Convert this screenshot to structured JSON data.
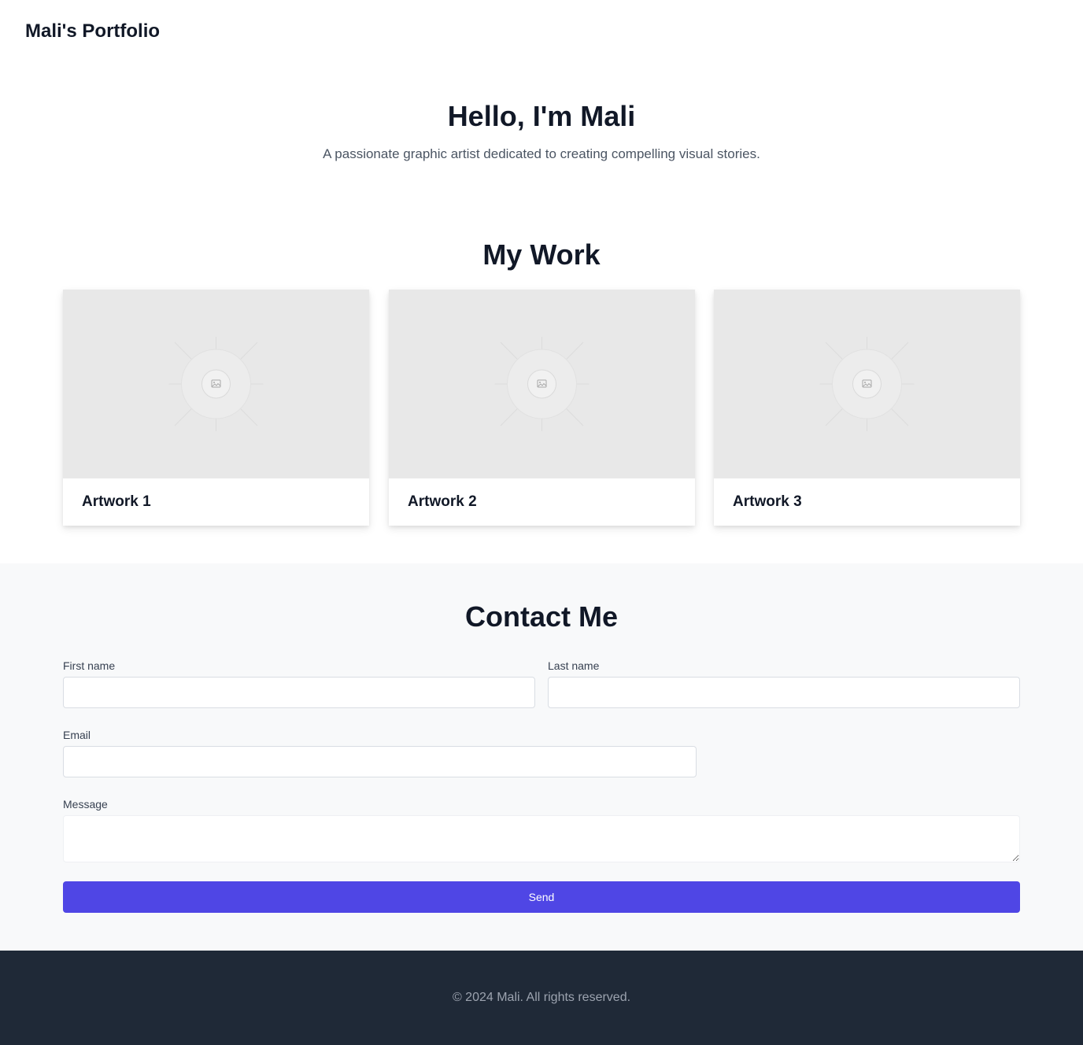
{
  "header": {
    "brand": "Mali's Portfolio"
  },
  "hero": {
    "title": "Hello, I'm Mali",
    "subtitle": "A passionate graphic artist dedicated to creating compelling visual stories."
  },
  "work": {
    "title": "My Work",
    "items": [
      {
        "label": "Artwork 1",
        "icon": "image-placeholder-icon"
      },
      {
        "label": "Artwork 2",
        "icon": "image-placeholder-icon"
      },
      {
        "label": "Artwork 3",
        "icon": "image-placeholder-icon"
      }
    ]
  },
  "contact": {
    "title": "Contact Me",
    "first_name": {
      "label": "First name",
      "value": ""
    },
    "last_name": {
      "label": "Last name",
      "value": ""
    },
    "email": {
      "label": "Email",
      "value": ""
    },
    "message": {
      "label": "Message",
      "value": ""
    },
    "send_label": "Send"
  },
  "footer": {
    "text": "© 2024 Mali. All rights reserved."
  },
  "colors": {
    "accent": "#4f46e5",
    "footer_bg": "#1f2937",
    "contact_bg": "#f8f9fa",
    "placeholder_bg": "#e8e8e8"
  }
}
